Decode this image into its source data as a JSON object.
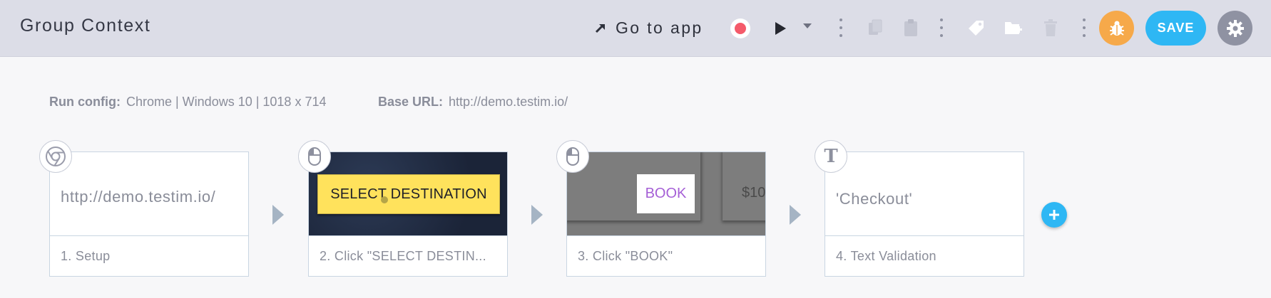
{
  "header": {
    "title": "Group Context",
    "goto_label": "Go to app",
    "save_label": "SAVE",
    "icons": [
      "arrow-up-right-icon",
      "record-icon",
      "play-icon",
      "caret-down-icon",
      "copy-icon",
      "paste-icon",
      "tag-icon",
      "folder-add-icon",
      "trash-icon",
      "bug-icon",
      "gear-icon"
    ],
    "colors": {
      "accent": "#2eb7f4",
      "record": "#f45a6a",
      "bug": "#f6a94a",
      "settings": "#8f92a2"
    }
  },
  "config": {
    "run_label": "Run config:",
    "run_value": "Chrome | Windows 10 | 1018 x 714",
    "base_label": "Base URL:",
    "base_value": "http://demo.testim.io/"
  },
  "steps": [
    {
      "badge_icon": "chrome-icon",
      "thumb_text": "http://demo.testim.io/",
      "caption": "1. Setup"
    },
    {
      "badge_icon": "mouse-icon",
      "thumb_text": "SELECT DESTINATION",
      "caption": "2. Click \"SELECT DESTIN..."
    },
    {
      "badge_icon": "mouse-icon",
      "thumb_text": "BOOK",
      "thumb_text_2": "$10",
      "caption": "3. Click \"BOOK\""
    },
    {
      "badge_icon": "text-icon",
      "badge_letter": "T",
      "thumb_text": "'Checkout'",
      "caption": "4. Text Validation"
    }
  ],
  "add_step_icon": "plus-icon"
}
